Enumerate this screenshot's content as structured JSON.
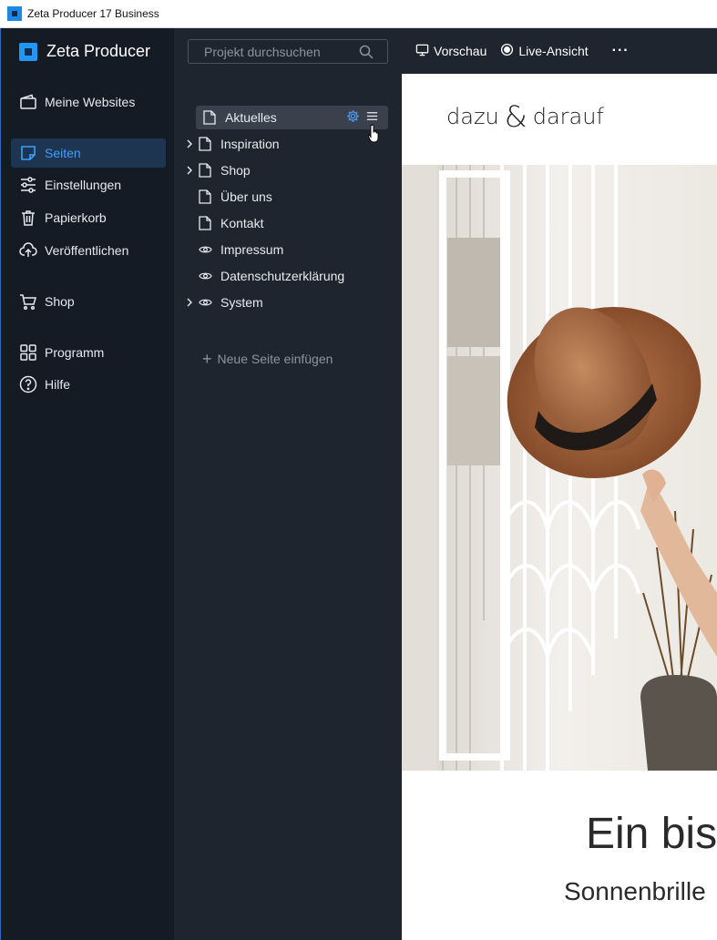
{
  "window": {
    "title": "Zeta Producer 17 Business"
  },
  "brand": {
    "name": "Zeta Producer"
  },
  "nav": {
    "items": [
      {
        "label": "Meine Websites",
        "icon": "wallet-icon"
      },
      {
        "label": "Seiten",
        "icon": "pages-icon",
        "active": true
      },
      {
        "label": "Einstellungen",
        "icon": "sliders-icon"
      },
      {
        "label": "Papierkorb",
        "icon": "trash-icon"
      },
      {
        "label": "Veröffentlichen",
        "icon": "cloud-upload-icon"
      },
      {
        "label": "Shop",
        "icon": "cart-icon"
      },
      {
        "label": "Programm",
        "icon": "grid-icon"
      },
      {
        "label": "Hilfe",
        "icon": "help-icon"
      }
    ]
  },
  "search": {
    "placeholder": "Projekt durchsuchen"
  },
  "tree": {
    "items": [
      {
        "label": "Aktuelles",
        "icon": "page-icon",
        "expandable": false,
        "selected": true
      },
      {
        "label": "Inspiration",
        "icon": "page-icon",
        "expandable": true
      },
      {
        "label": "Shop",
        "icon": "page-icon",
        "expandable": true
      },
      {
        "label": "Über uns",
        "icon": "page-icon",
        "expandable": false
      },
      {
        "label": "Kontakt",
        "icon": "page-icon",
        "expandable": false
      },
      {
        "label": "Impressum",
        "icon": "eye-icon",
        "expandable": false
      },
      {
        "label": "Datenschutzerklärung",
        "icon": "eye-icon",
        "expandable": false
      },
      {
        "label": "System",
        "icon": "eye-icon",
        "expandable": true
      }
    ],
    "add_page_label": "Neue Seite einfügen"
  },
  "toolbar": {
    "preview_label": "Vorschau",
    "live_label": "Live-Ansicht",
    "more_label": "···"
  },
  "preview": {
    "logo_left": "dazu",
    "logo_amp": "&",
    "logo_right": "darauf",
    "headline": "Ein bis",
    "subline": "Sonnenbrille"
  },
  "colors": {
    "accent": "#3fa0ff",
    "nav_bg": "#151b24",
    "panel_bg": "#1f252f",
    "selected_row": "#3a414c"
  }
}
